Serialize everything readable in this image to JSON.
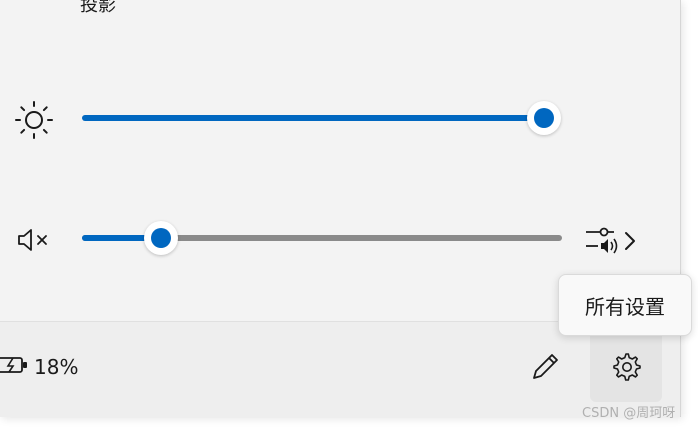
{
  "panel": {
    "projection_label": "投影"
  },
  "brightness": {
    "icon": "brightness-sun-icon",
    "level": 1.0,
    "track_color": "#0067c0"
  },
  "volume": {
    "icon": "speaker-muted-icon",
    "level": 0.1,
    "fill_color": "#0067c0",
    "track_color": "#8a8a8a",
    "mixer_icon": "audio-mixer-icon",
    "chevron_icon": "chevron-right-icon"
  },
  "footer": {
    "battery_icon": "battery-charging-icon",
    "battery_percent": "18%",
    "edit_icon": "pencil-icon",
    "settings_icon": "gear-icon"
  },
  "tooltip": {
    "text": "所有设置"
  },
  "watermark": {
    "text": "CSDN @周珂呀"
  }
}
